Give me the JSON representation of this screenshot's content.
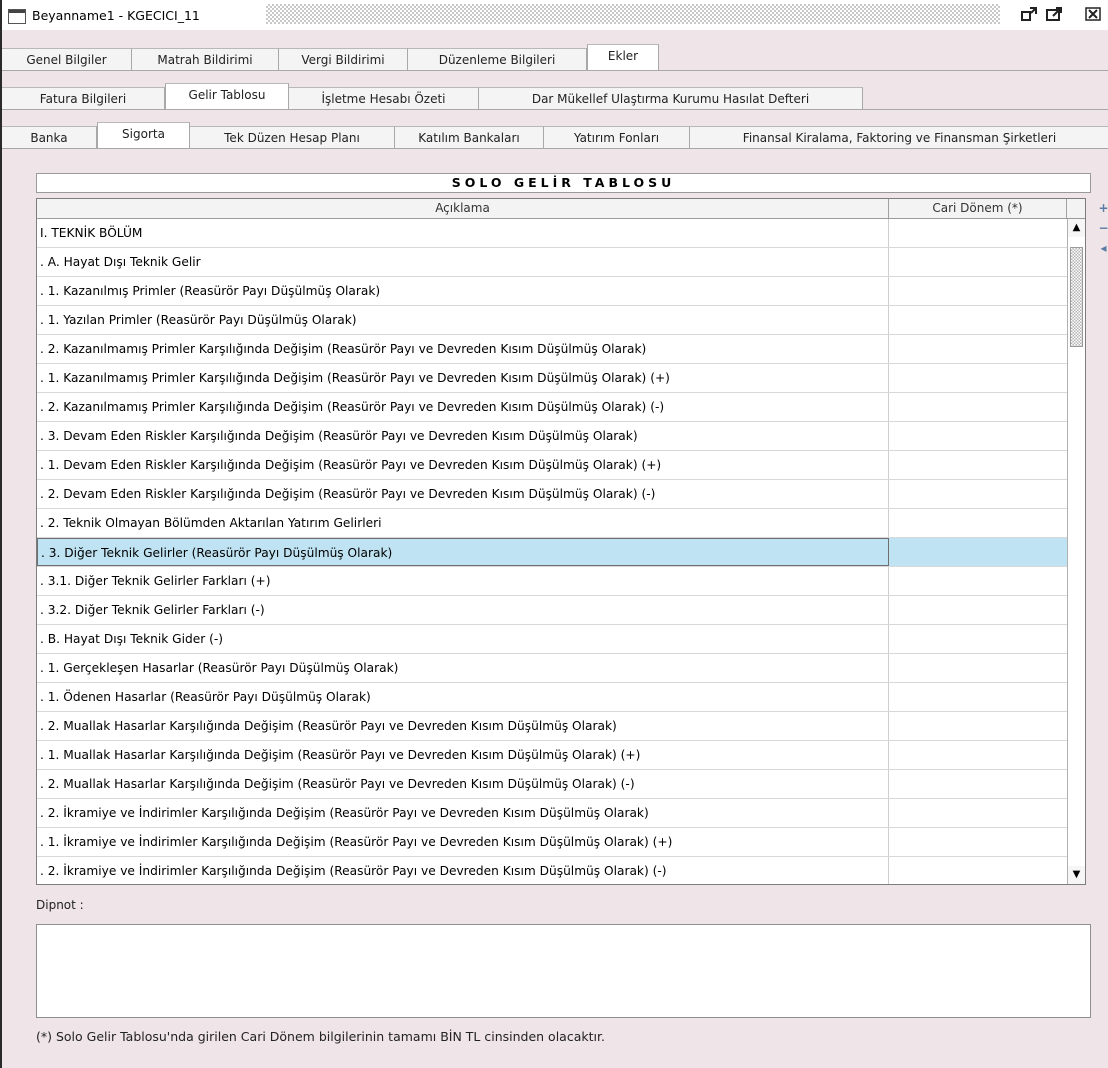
{
  "window": {
    "title": "Beyanname1 - KGECICI_11"
  },
  "main_tabs": [
    "Genel Bilgiler",
    "Matrah Bildirimi",
    "Vergi Bildirimi",
    "Düzenleme Bilgileri",
    "Ekler"
  ],
  "sub_tabs": [
    "Fatura Bilgileri",
    "Gelir Tablosu",
    "İşletme Hesabı Özeti",
    "Dar Mükellef Ulaştırma Kurumu Hasılat Defteri"
  ],
  "inner_tabs": [
    "Banka",
    "Sigorta",
    "Tek Düzen Hesap Planı",
    "Katılım Bankaları",
    "Yatırım Fonları",
    "Finansal Kiralama, Faktoring ve Finansman Şirketleri"
  ],
  "panel": {
    "title": "SOLO GELİR TABLOSU"
  },
  "table": {
    "columns": [
      "Açıklama",
      "Cari Dönem (*)"
    ],
    "rows": [
      "I. TEKNİK BÖLÜM",
      ". A. Hayat Dışı Teknik Gelir",
      ".   1. Kazanılmış Primler (Reasürör Payı Düşülmüş Olarak)",
      ".     1. Yazılan Primler (Reasürör Payı Düşülmüş Olarak)",
      ".     2. Kazanılmamış Primler Karşılığında Değişim (Reasürör Payı ve Devreden Kısım Düşülmüş Olarak)",
      ".       1. Kazanılmamış Primler Karşılığında Değişim (Reasürör Payı ve Devreden Kısım Düşülmüş Olarak) (+)",
      ".       2. Kazanılmamış Primler Karşılığında Değişim (Reasürör Payı ve Devreden Kısım Düşülmüş Olarak) (-)",
      ".     3. Devam Eden Riskler Karşılığında Değişim (Reasürör Payı ve Devreden Kısım Düşülmüş Olarak)",
      ".       1. Devam Eden Riskler Karşılığında Değişim (Reasürör Payı ve Devreden Kısım Düşülmüş Olarak) (+)",
      ".       2. Devam Eden Riskler Karşılığında Değişim (Reasürör Payı ve Devreden Kısım Düşülmüş Olarak) (-)",
      ".   2. Teknik Olmayan Bölümden Aktarılan Yatırım Gelirleri",
      ".   3. Diğer Teknik Gelirler (Reasürör Payı Düşülmüş Olarak)",
      ".       3.1. Diğer Teknik Gelirler Farkları (+)",
      ".       3.2. Diğer Teknik Gelirler Farkları (-)",
      ". B. Hayat Dışı Teknik Gider (-)",
      ".   1. Gerçekleşen Hasarlar (Reasürör Payı Düşülmüş Olarak)",
      ".     1. Ödenen Hasarlar (Reasürör Payı Düşülmüş Olarak)",
      ".     2. Muallak Hasarlar Karşılığında Değişim (Reasürör Payı ve Devreden Kısım Düşülmüş Olarak)",
      ".       1. Muallak Hasarlar Karşılığında Değişim (Reasürör Payı ve Devreden Kısım Düşülmüş Olarak) (+)",
      ".       2. Muallak Hasarlar Karşılığında Değişim (Reasürör Payı ve Devreden Kısım Düşülmüş Olarak) (-)",
      ".   2. İkramiye ve İndirimler Karşılığında Değişim (Reasürör Payı ve Devreden Kısım Düşülmüş Olarak)",
      ".     1. İkramiye ve İndirimler Karşılığında Değişim (Reasürör Payı ve Devreden Kısım Düşülmüş Olarak) (+)",
      ".     2. İkramiye ve İndirimler Karşılığında Değişim (Reasürör Payı ve Devreden Kısım Düşülmüş Olarak) (-)"
    ],
    "selected_row": 11
  },
  "dipnot": {
    "label": "Dipnot :",
    "value": ""
  },
  "footnote": "(*) Solo Gelir Tablosu'nda girilen Cari Dönem bilgilerinin tamamı BİN TL cinsinden olacaktır.",
  "icons": {
    "restore": "restore-icon",
    "maximize": "maximize-icon",
    "close": "close-icon",
    "scroll_up": "arrow-up-icon",
    "scroll_down": "arrow-down-icon",
    "add_row": "plus-icon",
    "remove_row": "minus-icon",
    "back": "arrow-left-icon"
  },
  "colors": {
    "selection": "#bfe3f2",
    "background": "#efe4e7"
  }
}
